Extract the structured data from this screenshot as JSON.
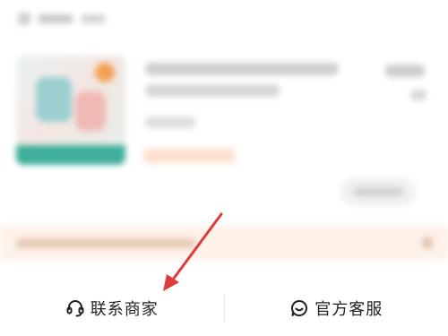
{
  "bottom_bar": {
    "contact_merchant_label": "联系商家",
    "contact_merchant_icon": "headset-icon",
    "official_service_label": "官方客服",
    "official_service_icon": "chat-bubble-icon"
  },
  "colors": {
    "annotation_arrow": "#e03b3b",
    "notice_background": "#fdf1e8",
    "text": "#222222"
  }
}
